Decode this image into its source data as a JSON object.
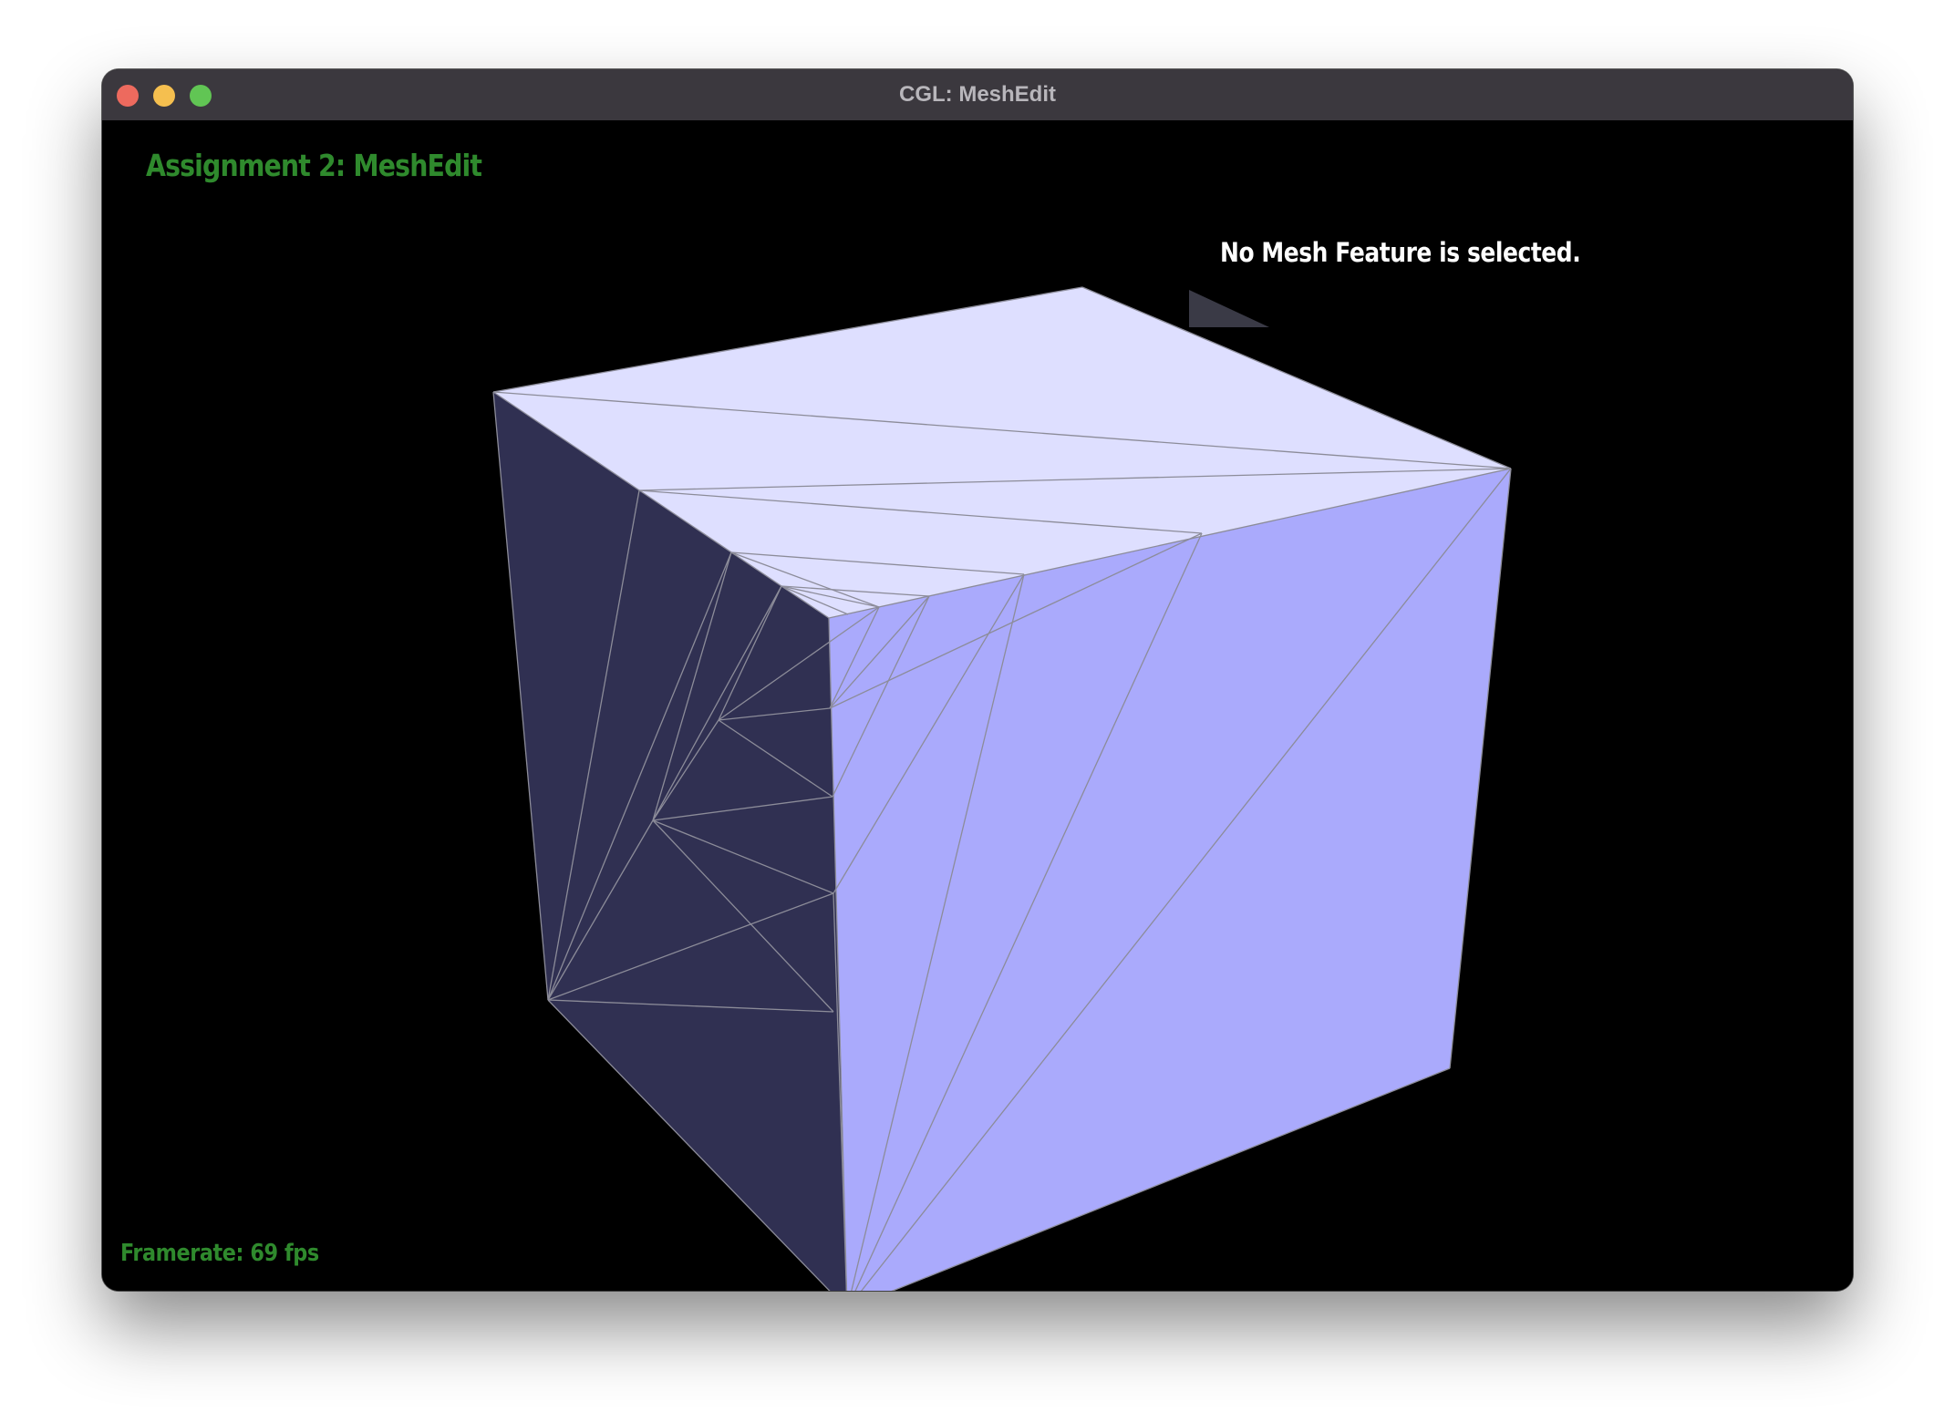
{
  "window": {
    "title": "CGL: MeshEdit"
  },
  "overlay": {
    "app_title": "Assignment 2: MeshEdit",
    "selection_status": "No Mesh Feature is selected.",
    "framerate_label": "Framerate: 69 fps"
  },
  "colors": {
    "titlebar": "#3b383e",
    "viewport_background": "#000000",
    "hud_green": "#2f8a2d",
    "cube_top_face": "#dedfff",
    "cube_right_face": "#aaaafc",
    "cube_left_face": "#303052",
    "wireframe_edges": "#8c8c99"
  },
  "icons": {
    "close": "red-circle",
    "minimize": "yellow-circle",
    "zoom": "green-circle"
  }
}
